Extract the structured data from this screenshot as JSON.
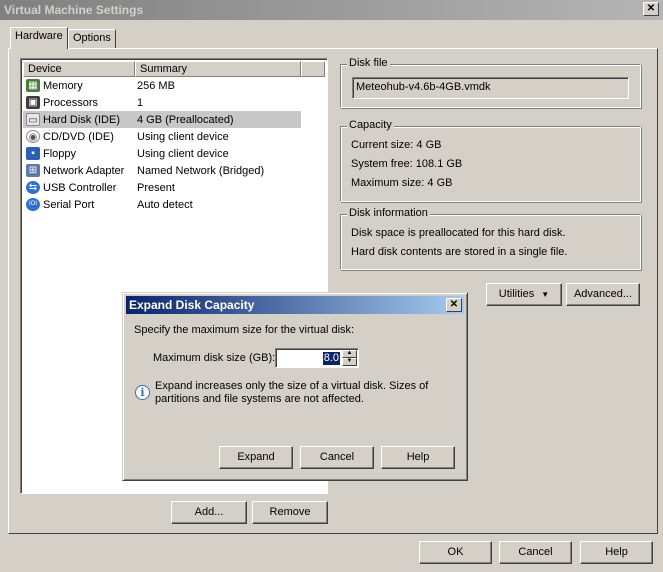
{
  "window": {
    "title": "Virtual Machine Settings",
    "close_glyph": "✕"
  },
  "tabs": [
    {
      "label": "Hardware"
    },
    {
      "label": "Options"
    }
  ],
  "device_list": {
    "columns": [
      "Device",
      "Summary"
    ],
    "rows": [
      {
        "device": "Memory",
        "summary": "256 MB",
        "icon": "memory-icon"
      },
      {
        "device": "Processors",
        "summary": "1",
        "icon": "processor-icon"
      },
      {
        "device": "Hard Disk (IDE)",
        "summary": "4 GB (Preallocated)",
        "icon": "hard-disk-icon"
      },
      {
        "device": "CD/DVD (IDE)",
        "summary": "Using client device",
        "icon": "cd-dvd-icon"
      },
      {
        "device": "Floppy",
        "summary": "Using client device",
        "icon": "floppy-icon"
      },
      {
        "device": "Network Adapter",
        "summary": "Named Network (Bridged)",
        "icon": "network-adapter-icon"
      },
      {
        "device": "USB Controller",
        "summary": "Present",
        "icon": "usb-icon"
      },
      {
        "device": "Serial Port",
        "summary": "Auto detect",
        "icon": "serial-port-icon"
      }
    ]
  },
  "disk_file": {
    "legend": "Disk file",
    "value": "Meteohub-v4.6b-4GB.vmdk"
  },
  "capacity": {
    "legend": "Capacity",
    "current": "Current size:  4 GB",
    "free": "System free:  108.1 GB",
    "maximum": "Maximum size:  4 GB"
  },
  "disk_info": {
    "legend": "Disk information",
    "line1": "Disk space is preallocated for this hard disk.",
    "line2": "Hard disk contents are stored in a single file."
  },
  "buttons": {
    "utilities": "Utilities",
    "advanced": "Advanced...",
    "add": "Add...",
    "remove": "Remove",
    "ok": "OK",
    "cancel": "Cancel",
    "help": "Help"
  },
  "dialog": {
    "title": "Expand Disk Capacity",
    "prompt": "Specify the maximum size for the virtual disk:",
    "field_label": "Maximum disk size (GB):",
    "field_value": "8.0",
    "info": "Expand increases only the size of a virtual disk. Sizes of partitions and file systems are not affected.",
    "expand": "Expand",
    "cancel": "Cancel",
    "help": "Help"
  },
  "colors": {
    "title_active": "#0a246a",
    "title_inactive": "#808080",
    "face": "#d4d0c8"
  }
}
